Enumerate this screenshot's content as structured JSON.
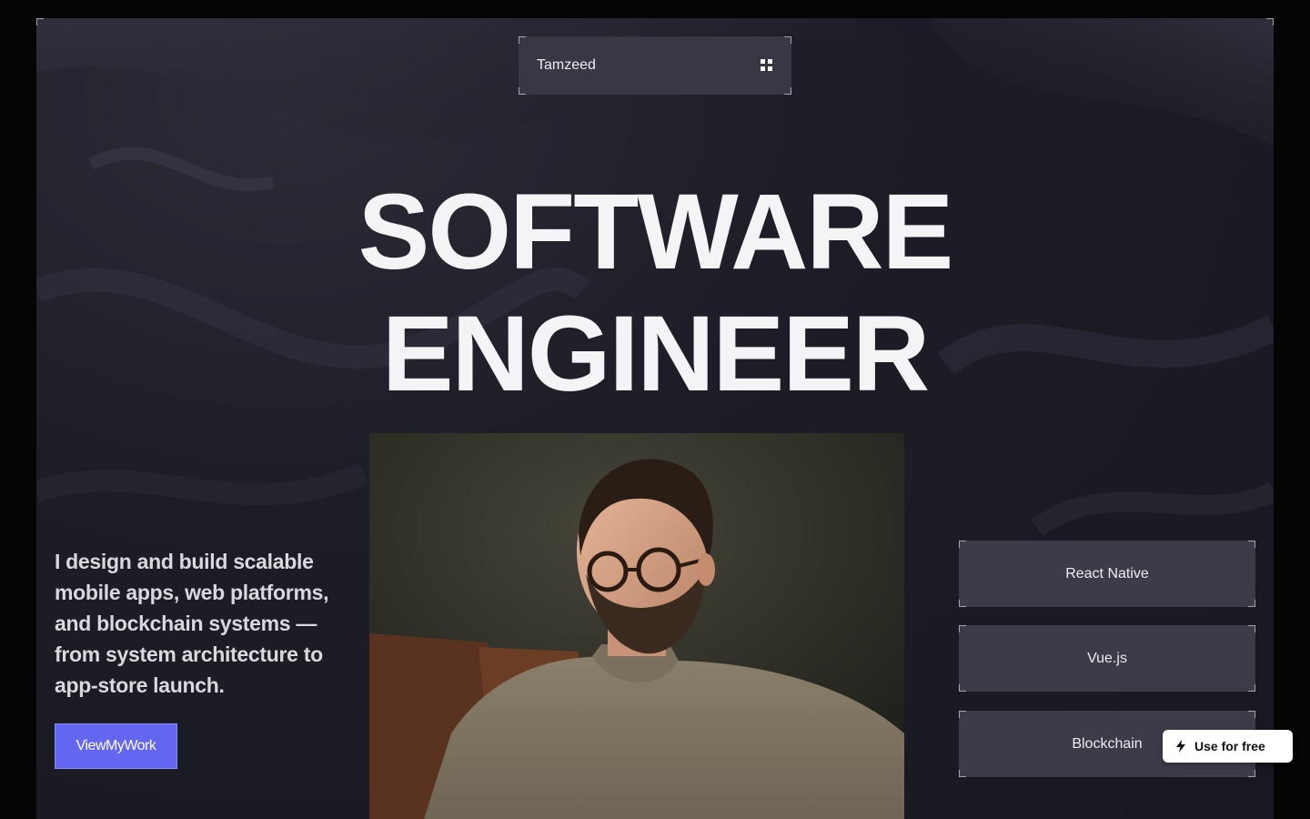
{
  "navbar": {
    "brand": "Tamzeed",
    "menu_icon": "grid-menu-icon"
  },
  "hero": {
    "title_line1": "SOFTWARE",
    "title_line2": "ENGINEER"
  },
  "intro": {
    "text": "I design and build scalable mobile apps, web platforms, and blockchain systems — from system architecture to app-store launch."
  },
  "cta": {
    "label": "ViewMyWork"
  },
  "photo": {
    "subject": "portrait-photo"
  },
  "skills": [
    {
      "label": "React Native"
    },
    {
      "label": "Vue.js"
    },
    {
      "label": "Blockchain"
    }
  ],
  "badge": {
    "label": "Use for free",
    "icon": "lightning-icon"
  },
  "colors": {
    "background": "#1d1d27",
    "accent": "#6366f1",
    "card": "#3c3c48",
    "text": "#f4f4f6"
  }
}
